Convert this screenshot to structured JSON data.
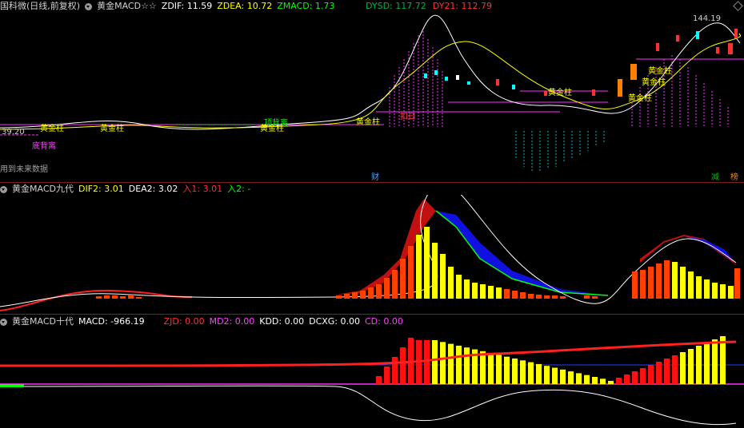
{
  "window": {
    "title": "国科微(日线,前复权)",
    "indicator_name": "黄金MACD☆☆",
    "values": [
      {
        "label": "ZDIF: 11.59",
        "color": "#ffffff"
      },
      {
        "label": "ZDEA: 10.72",
        "color": "#ffff00"
      },
      {
        "label": "ZMACD: 1.73",
        "color": "#00ff00"
      },
      {
        "label": "DYSD: 117.72",
        "color": "#00b050"
      },
      {
        "label": "DY21: 112.79",
        "color": "#ff3030"
      }
    ]
  },
  "main_chart": {
    "price_label": "144.19",
    "left_label": "39.20",
    "future_data_label": "用到未来数据",
    "annotations": [
      {
        "text": "黄金柱",
        "color": "#ffff00"
      },
      {
        "text": "黄金柱",
        "color": "#ffff00"
      },
      {
        "text": "顶背离",
        "color": "#00ff00"
      },
      {
        "text": "黄金柱",
        "color": "#ffff00"
      },
      {
        "text": "黄金柱",
        "color": "#ffff00"
      },
      {
        "text": "扣日",
        "color": "#ff4040"
      },
      {
        "text": "底背离",
        "color": "#ff40ff"
      },
      {
        "text": "黄金柱",
        "color": "#ffff00"
      },
      {
        "text": "黄金柱",
        "color": "#ffff00"
      },
      {
        "text": "黄金柱",
        "color": "#ffff00"
      },
      {
        "text": "黄金柱",
        "color": "#ffff00"
      }
    ],
    "tags": [
      {
        "text": "财",
        "color": "#4aa3ff"
      },
      {
        "text": "减",
        "color": "#00c000"
      },
      {
        "text": "榜",
        "color": "#ff8000"
      }
    ]
  },
  "panel2": {
    "name": "黄金MACD九代",
    "values": [
      {
        "label": "DIF2: 3.01",
        "color": "#ffff00"
      },
      {
        "label": "DEA2: 3.02",
        "color": "#ffffff"
      },
      {
        "label": "入1: 3.01",
        "color": "#ff3030"
      },
      {
        "label": "入2: -",
        "color": "#00ff00"
      }
    ]
  },
  "panel3": {
    "name": "黄金MACD十代",
    "values": [
      {
        "label": "MACD: -966.19",
        "color": "#ffffff"
      },
      {
        "label": "ZJD: 0.00",
        "color": "#ff3030"
      },
      {
        "label": "MD2: 0.00",
        "color": "#ff40ff"
      },
      {
        "label": "KDD: 0.00",
        "color": "#ffffff"
      },
      {
        "label": "DCXG: 0.00",
        "color": "#ffffff"
      },
      {
        "label": "CD: 0.00",
        "color": "#ff40ff"
      }
    ]
  }
}
